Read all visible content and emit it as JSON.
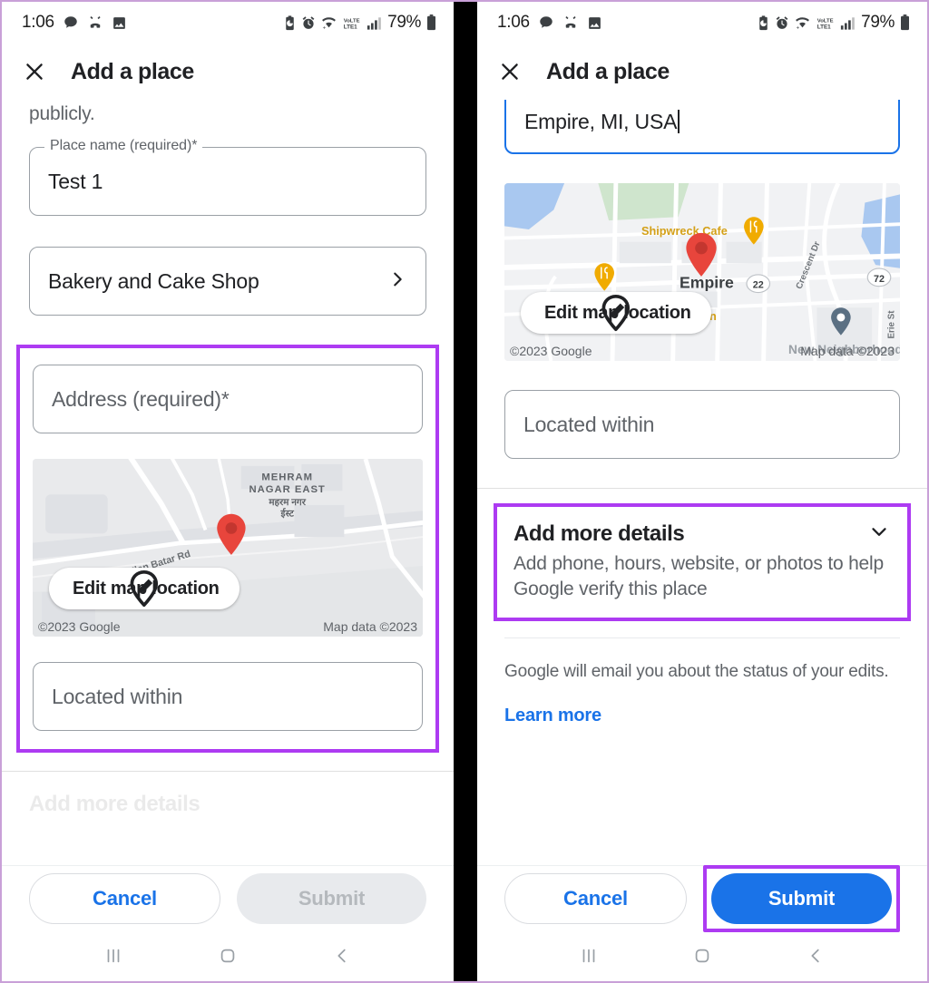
{
  "status_bar": {
    "time": "1:06",
    "battery_percent": "79%",
    "left_icons": [
      "chat-bubble-icon",
      "missed-call-icon",
      "image-icon"
    ],
    "right_icons": [
      "battery-saver-icon",
      "alarm-icon",
      "wifi-icon",
      "volte-lte-icon",
      "signal-bars-icon",
      "battery-icon"
    ],
    "network_label": "LTE1",
    "volte_label": "VoLTE"
  },
  "header": {
    "title": "Add a place",
    "close_icon": "close-icon"
  },
  "left_panel": {
    "lead_text": "publicly.",
    "place_name": {
      "label": "Place name (required)*",
      "value": "Test 1"
    },
    "category": {
      "value": "Bakery and Cake Shop",
      "chevron_icon": "chevron-right-icon"
    },
    "address": {
      "placeholder": "Address (required)*",
      "value": ""
    },
    "map": {
      "edit_button_label": "Edit map location",
      "edit_icon": "edit-location-pin-icon",
      "attribution_left": "©2023 Google",
      "attribution_right": "Map data ©2023",
      "labels": [
        "MEHRAM",
        "NAGAR EAST",
        "महरम  नगर",
        "ईस्ट",
        "Ulan Batar Rd"
      ],
      "pin_color": "#e8453c"
    },
    "located_within": {
      "placeholder": "Located within",
      "value": ""
    },
    "actions": {
      "cancel_label": "Cancel",
      "submit_label": "Submit",
      "submit_enabled": false
    },
    "highlight_color": "#ad3bf2"
  },
  "right_panel": {
    "address": {
      "value": "Empire, MI, USA",
      "focused": true
    },
    "map": {
      "edit_button_label": "Edit map location",
      "edit_icon": "edit-location-pin-icon",
      "attribution_left": "©2023 Google",
      "attribution_right": "Map data ©2023",
      "labels": [
        "Shipwreck Cafe",
        "Empire",
        "Joe's Friendly Tavern",
        "Crescent Dr",
        "Erie St",
        "New Neighborhood"
      ],
      "route_shields": [
        "22",
        "72"
      ],
      "pin_color": "#e8453c",
      "poi_color": "#f0ab00"
    },
    "located_within": {
      "placeholder": "Located within",
      "value": ""
    },
    "add_more_details": {
      "title": "Add more details",
      "subtitle": "Add phone, hours, website, or photos to help Google verify this place",
      "chevron_icon": "chevron-down-icon"
    },
    "note": "Google will email you about the status of your edits.",
    "learn_more": "Learn more",
    "actions": {
      "cancel_label": "Cancel",
      "submit_label": "Submit",
      "submit_enabled": true
    },
    "highlight_color": "#ad3bf2"
  },
  "nav_bar": {
    "recents_icon": "recents-icon",
    "home_icon": "home-icon",
    "back_icon": "back-icon"
  },
  "colors": {
    "accent_blue": "#1a73e8",
    "highlight_purple": "#ad3bf2",
    "text_primary": "#202124",
    "text_secondary": "#5f6368",
    "frame_border": "#c9a0d8"
  }
}
